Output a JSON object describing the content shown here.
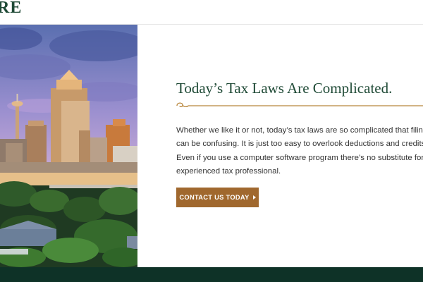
{
  "header": {
    "logo_text": "RE"
  },
  "hero": {
    "photo_alt": "city skyline at dusk"
  },
  "main": {
    "heading": "Today’s Tax Laws Are Complicated.",
    "body_lines": [
      "Whether we like it or not, today’s tax laws are so complicated that filing a re",
      "can be confusing. It is just too easy to overlook deductions and credits to w",
      "Even if you use a computer software program there’s no substitute for the a",
      "experienced tax professional."
    ],
    "cta_label": "CONTACT US TODAY"
  },
  "icons": {
    "divider": "scroll-ornament-icon",
    "cta_arrow": "caret-right-icon"
  },
  "colors": {
    "brand_green": "#1f4a36",
    "accent_gold": "#b8863c",
    "button": "#a0682e",
    "footer": "#0e3227"
  }
}
